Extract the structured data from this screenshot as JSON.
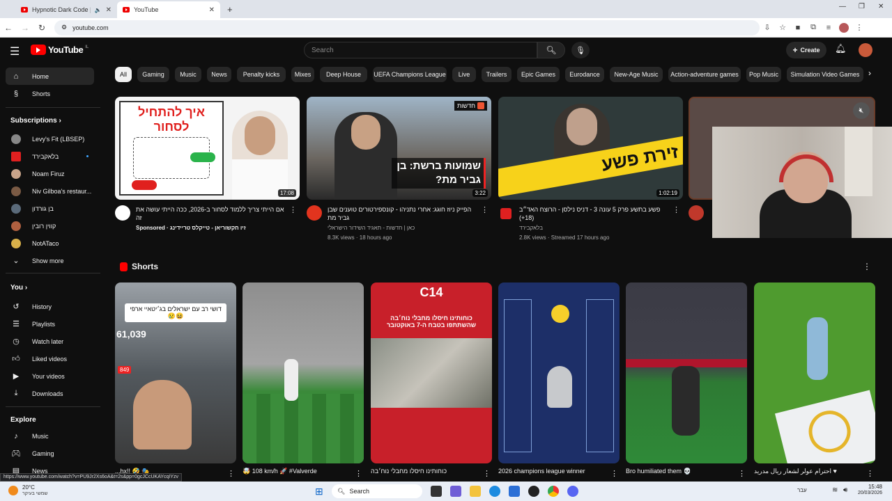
{
  "browser": {
    "tabs": [
      {
        "label": "Hypnotic Dark Code | Futur"
      },
      {
        "label": "YouTube"
      }
    ],
    "url": "youtube.com"
  },
  "yt": {
    "logo": "YouTube",
    "region": "IL",
    "search_placeholder": "Search",
    "create": "Create",
    "sidebar": {
      "home": "Home",
      "shorts": "Shorts",
      "subscriptions": "Subscriptions",
      "subs": [
        "Levy's Fit (LBSEP)",
        "בלאקבירד",
        "Noam Firuz",
        "Niv Gilboa's restaur...",
        "בן גורדון",
        "קווין רובין",
        "NotATaco"
      ],
      "show_more": "Show more",
      "you": "You",
      "you_items": [
        "History",
        "Playlists",
        "Watch later",
        "Liked videos",
        "Your videos",
        "Downloads"
      ],
      "explore": "Explore",
      "explore_items": [
        "Music",
        "Gaming",
        "News"
      ]
    },
    "chips": [
      "All",
      "Gaming",
      "Music",
      "News",
      "Penalty kicks",
      "Mixes",
      "Deep House",
      "UEFA Champions League",
      "Live",
      "Trailers",
      "Epic Games",
      "Eurodance",
      "New-Age Music",
      "Action-adventure games",
      "Pop Music",
      "Simulation Video Games"
    ],
    "videos": [
      {
        "title": "אם הייתי צריך ללמוד לסחור ב-2026, ככה הייתי עושה את זה",
        "channel": "Sponsored · זיו חקשוריאן - טייקלס טריידינג",
        "stats": "",
        "duration": "17:08",
        "thumb_text": "איך להתחיל לסחור"
      },
      {
        "title": "הפייק ניוז חוגג: אחרי נתניהו - קונספירטורים טוענים שבן גביר מת",
        "channel": "כאן | חדשות - תאגיד השידור הישראלי",
        "stats": "8.3K views · 18 hours ago",
        "duration": "3:22",
        "thumb_text": "שמועות ברשת: בן גביר מת?",
        "thumb_label": "חדשות"
      },
      {
        "title": "פשע בתשע פרק 5 עונה 3 - דניס נילסן - הרוצח האד״ב (18+)",
        "channel": "בלאקבירד",
        "stats": "2.8K views · Streamed 17 hours ago",
        "duration": "1:02:19",
        "thumb_text": "זירת פשע"
      }
    ],
    "shorts_title": "Shorts",
    "shorts": [
      {
        "title": "...hx!! 🤣 🎭",
        "overlay": "דושי רב עם ישראלים בג׳יטאיי ארפי 😆😢",
        "count": "61,039",
        "tag": "849"
      },
      {
        "title": "🤯 108 km/h 🚀 #Valverde",
        "overlay": ""
      },
      {
        "title": "כוחותינו חיסלו מחבלי נוח׳בה",
        "overlay": "כוחותינו חיסלו מחבלי נוח׳בה שהשתתפו בטבח ה-7 באוקטובר",
        "channel": "C14"
      },
      {
        "title": "2026 champions league winner",
        "overlay": ""
      },
      {
        "title": "Bro humiliated them 💀",
        "overlay": ""
      },
      {
        "title": "♥ احترام عولر لشعار ريال مدريد",
        "overlay": ""
      }
    ],
    "status_url": "https://www.youtube.com/watch?v=PU9Jr2Xs6oA&t=2s&pp=0gcJCcUKAYcqIYzv"
  },
  "taskbar": {
    "weather": "20°C",
    "weather_sub": "שמשי בעיקר",
    "search": "Search",
    "time": "15:48",
    "date": "20/03/2026",
    "lang": "עבר"
  }
}
